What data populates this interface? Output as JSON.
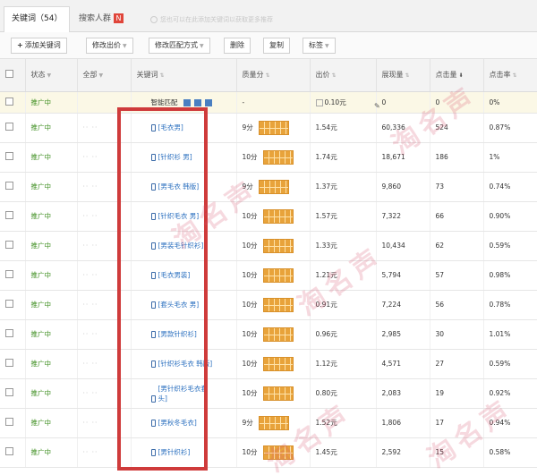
{
  "tabs": [
    {
      "label": "关键词（54）",
      "active": true
    },
    {
      "label": "搜索人群",
      "badge": "N"
    }
  ],
  "tab_hint": "您也可以在此添加关键词以获取更多推荐",
  "toolbar": {
    "add_keyword": "添加关键词",
    "edit_bid": "修改出价",
    "edit_match": "修改匹配方式",
    "delete": "删除",
    "copy": "复制",
    "tag": "标签"
  },
  "columns": [
    "状态",
    "全部",
    "关键词",
    "质量分",
    "出价",
    "展现量",
    "点击量",
    "点击率"
  ],
  "smart_row": {
    "status": "推广中",
    "keyword": "智能匹配",
    "quality": "-",
    "bid": "0.10元",
    "impressions": "0",
    "clicks": "0",
    "ctr": "0%"
  },
  "rows": [
    {
      "status": "推广中",
      "keyword": "[毛衣男]",
      "quality": "9分",
      "bid": "1.54元",
      "impressions": "60,336",
      "clicks": "524",
      "ctr": "0.87%"
    },
    {
      "status": "推广中",
      "keyword": "[针织衫 男]",
      "quality": "10分",
      "bid": "1.74元",
      "impressions": "18,671",
      "clicks": "186",
      "ctr": "1%"
    },
    {
      "status": "推广中",
      "keyword": "[男毛衣 韩版]",
      "quality": "9分",
      "bid": "1.37元",
      "impressions": "9,860",
      "clicks": "73",
      "ctr": "0.74%"
    },
    {
      "status": "推广中",
      "keyword": "[针织毛衣 男]",
      "quality": "10分",
      "bid": "1.57元",
      "impressions": "7,322",
      "clicks": "66",
      "ctr": "0.90%"
    },
    {
      "status": "推广中",
      "keyword": "[男装毛针织衫]",
      "quality": "10分",
      "bid": "1.33元",
      "impressions": "10,434",
      "clicks": "62",
      "ctr": "0.59%"
    },
    {
      "status": "推广中",
      "keyword": "[毛衣男装]",
      "quality": "10分",
      "bid": "1.21元",
      "impressions": "5,794",
      "clicks": "57",
      "ctr": "0.98%"
    },
    {
      "status": "推广中",
      "keyword": "[套头毛衣 男]",
      "quality": "10分",
      "bid": "0.91元",
      "impressions": "7,224",
      "clicks": "56",
      "ctr": "0.78%"
    },
    {
      "status": "推广中",
      "keyword": "[男款针织衫]",
      "quality": "10分",
      "bid": "0.96元",
      "impressions": "2,985",
      "clicks": "30",
      "ctr": "1.01%"
    },
    {
      "status": "推广中",
      "keyword": "[针织衫毛衣 韩版]",
      "quality": "10分",
      "bid": "1.12元",
      "impressions": "4,571",
      "clicks": "27",
      "ctr": "0.59%"
    },
    {
      "status": "推广中",
      "keyword": "[男针织衫毛衣套头]",
      "quality": "10分",
      "bid": "0.80元",
      "impressions": "2,083",
      "clicks": "19",
      "ctr": "0.92%"
    },
    {
      "status": "推广中",
      "keyword": "[男秋冬毛衣]",
      "quality": "9分",
      "bid": "1.52元",
      "impressions": "1,806",
      "clicks": "17",
      "ctr": "0.94%"
    },
    {
      "status": "推广中",
      "keyword": "[男针织衫]",
      "quality": "10分",
      "bid": "1.45元",
      "impressions": "2,592",
      "clicks": "15",
      "ctr": "0.58%"
    }
  ],
  "colors": {
    "status": "#3c8d1e",
    "link": "#2a6fbf",
    "highlight": "#cf3b3b",
    "quality_bar": "#e8a33b"
  }
}
